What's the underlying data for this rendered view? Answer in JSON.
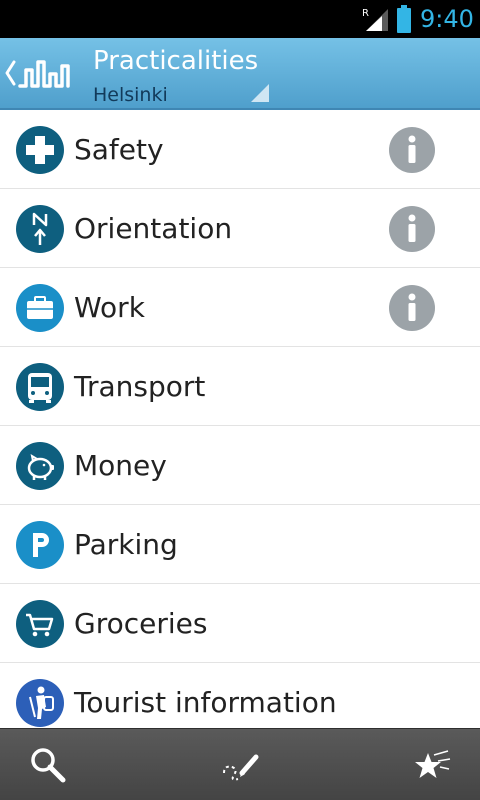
{
  "status_bar": {
    "time": "9:40",
    "roaming_indicator": "R",
    "accent_color": "#33b5e5",
    "icons": [
      "signal-icon",
      "battery-icon"
    ]
  },
  "action_bar": {
    "title": "Practicalities",
    "subtitle": "Helsinki",
    "background_color": "#5aaad6",
    "icons": [
      "up-chevron-icon",
      "city-skyline-logo-icon",
      "dropdown-triangle-icon"
    ]
  },
  "list": {
    "items": [
      {
        "label": "Safety",
        "icon": "medical-cross-icon",
        "has_info": true
      },
      {
        "label": "Orientation",
        "icon": "compass-north-icon",
        "has_info": true
      },
      {
        "label": "Work",
        "icon": "briefcase-icon",
        "has_info": true
      },
      {
        "label": "Transport",
        "icon": "bus-icon",
        "has_info": false
      },
      {
        "label": "Money",
        "icon": "piggy-bank-icon",
        "has_info": false
      },
      {
        "label": "Parking",
        "icon": "parking-icon",
        "has_info": false
      },
      {
        "label": "Groceries",
        "icon": "shopping-cart-icon",
        "has_info": false
      },
      {
        "label": "Tourist information",
        "icon": "tourist-info-icon",
        "has_info": false
      }
    ],
    "info_icon": "info-icon"
  },
  "bottom_bar": {
    "buttons": [
      "search-icon",
      "route-edit-icon",
      "favorites-stars-icon"
    ]
  }
}
